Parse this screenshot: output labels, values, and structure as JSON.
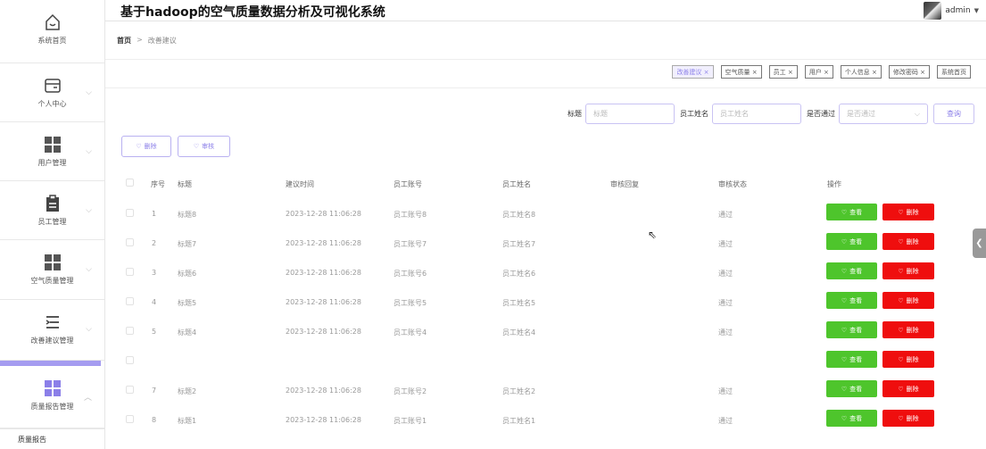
{
  "app": {
    "title": "基于hadoop的空气质量数据分析及可视化系统",
    "user": "admin"
  },
  "sidebar": {
    "home": "系统首页",
    "personal": "个人中心",
    "users": "用户管理",
    "staff": "员工管理",
    "air": "空气质量管理",
    "suggest": "改善建议管理",
    "report": "质量报告管理",
    "report_sub": "质量报告"
  },
  "breadcrumb": {
    "home": "首页",
    "sep": ">",
    "current": "改善建议"
  },
  "tags": [
    "改善建议 ×",
    "空气质量 ×",
    "员工 ×",
    "用户 ×",
    "个人信息 ×",
    "修改密码 ×",
    "系统首页"
  ],
  "search": {
    "title_label": "标题",
    "title_placeholder": "标题",
    "name_label": "员工姓名",
    "name_placeholder": "员工姓名",
    "pass_label": "是否通过",
    "pass_placeholder": "是否通过",
    "query": "查询"
  },
  "actions": {
    "delete": "删除",
    "audit": "审核"
  },
  "table": {
    "headers": [
      "序号",
      "标题",
      "建议时间",
      "员工账号",
      "员工姓名",
      "审核回复",
      "审核状态",
      "操作"
    ],
    "view": "查看",
    "del": "删除",
    "rows": [
      [
        "1",
        "标题8",
        "2023-12-28 11:06:28",
        "员工账号8",
        "员工姓名8",
        "",
        "通过"
      ],
      [
        "2",
        "标题7",
        "2023-12-28 11:06:28",
        "员工账号7",
        "员工姓名7",
        "",
        "通过"
      ],
      [
        "3",
        "标题6",
        "2023-12-28 11:06:28",
        "员工账号6",
        "员工姓名6",
        "",
        "通过"
      ],
      [
        "4",
        "标题5",
        "2023-12-28 11:06:28",
        "员工账号5",
        "员工姓名5",
        "",
        "通过"
      ],
      [
        "5",
        "标题4",
        "2023-12-28 11:06:28",
        "员工账号4",
        "员工姓名4",
        "",
        "通过"
      ],
      [
        "",
        "",
        "",
        "",
        "",
        "",
        ""
      ],
      [
        "7",
        "标题2",
        "2023-12-28 11:06:28",
        "员工账号2",
        "员工姓名2",
        "",
        "通过"
      ],
      [
        "8",
        "标题1",
        "2023-12-28 11:06:28",
        "员工账号1",
        "员工姓名1",
        "",
        "通过"
      ]
    ]
  },
  "colors": {
    "accent": "#8b7fe8",
    "view": "#4ec52c",
    "delete": "#ef0e0e"
  },
  "icons": [
    "home-icon",
    "wallet-icon",
    "grid-icon",
    "clipboard-icon",
    "list-icon",
    "heart-icon",
    "chevron-left-icon"
  ]
}
